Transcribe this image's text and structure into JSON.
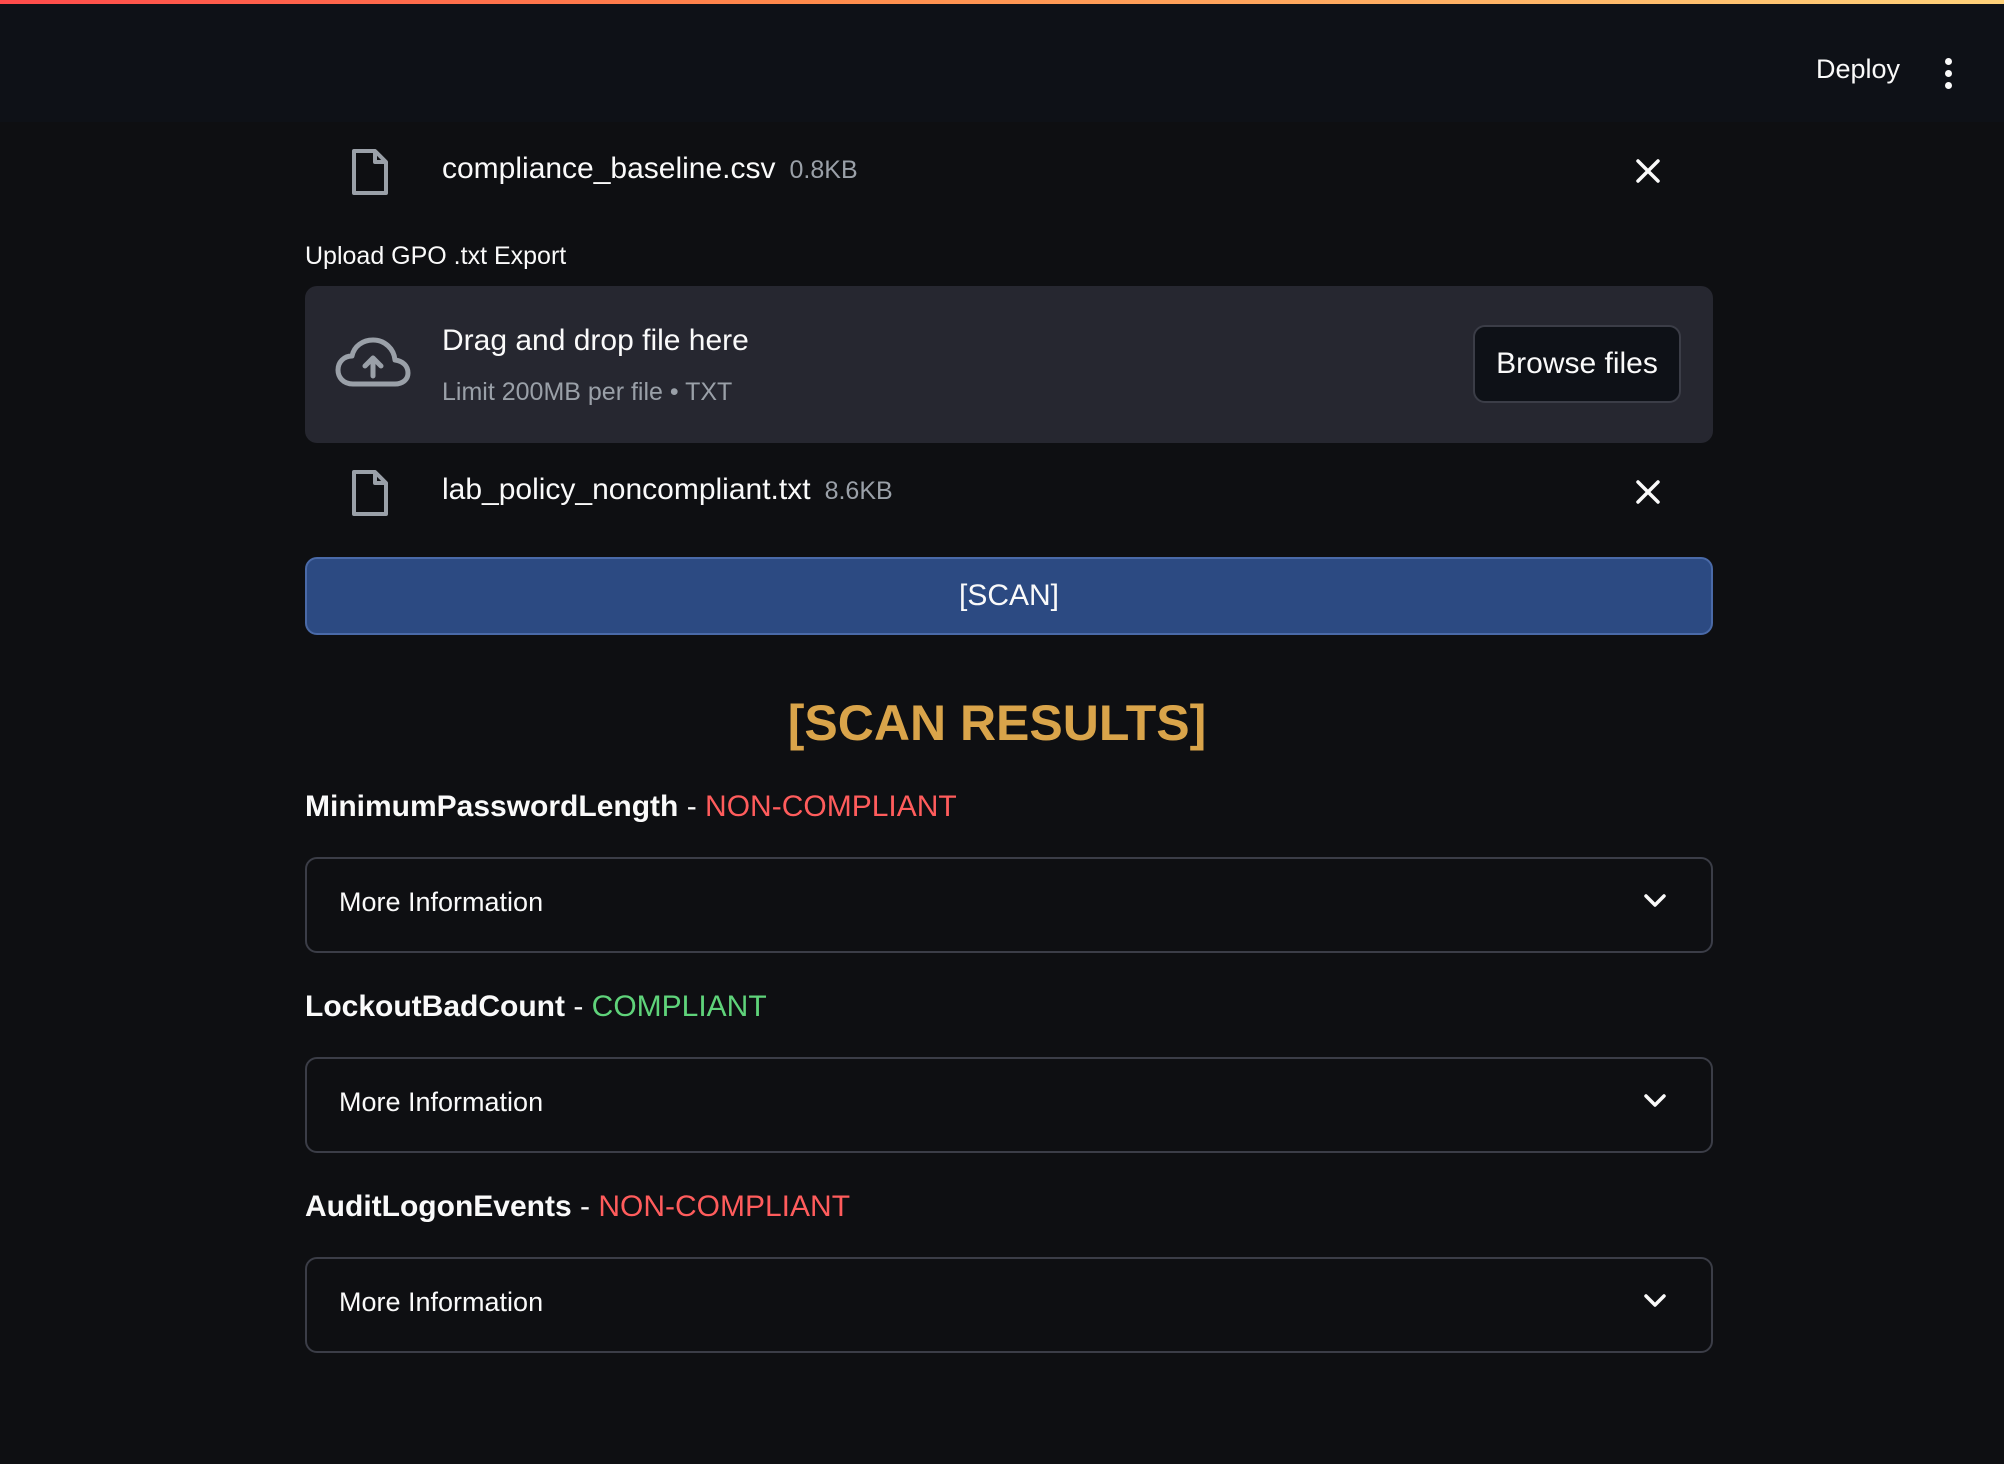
{
  "header": {
    "deploy_label": "Deploy"
  },
  "baseline_file": {
    "name": "compliance_baseline.csv",
    "size": "0.8KB"
  },
  "uploader": {
    "label": "Upload GPO .txt Export",
    "drop_title": "Drag and drop file here",
    "drop_sub": "Limit 200MB per file • TXT",
    "browse_label": "Browse files"
  },
  "policy_file": {
    "name": "lab_policy_noncompliant.txt",
    "size": "8.6KB"
  },
  "scan_button_label": "[SCAN]",
  "results": {
    "heading": "[SCAN RESULTS]",
    "separator": "-",
    "items": [
      {
        "setting": "MinimumPasswordLength",
        "status": "NON-COMPLIANT",
        "expander_label": "More Information"
      },
      {
        "setting": "LockoutBadCount",
        "status": "COMPLIANT",
        "expander_label": "More Information"
      },
      {
        "setting": "AuditLogonEvents",
        "status": "NON-COMPLIANT",
        "expander_label": "More Information"
      }
    ]
  },
  "colors": {
    "noncompliant": "#ff5c5c",
    "compliant": "#5fd37a",
    "heading": "#d9a44a",
    "scan_button": "#2c4a82"
  },
  "icons": {
    "file": "file-icon",
    "close": "close-icon",
    "upload": "cloud-upload-icon",
    "expand": "chevron-down-icon",
    "menu": "vertical-dots-icon"
  }
}
